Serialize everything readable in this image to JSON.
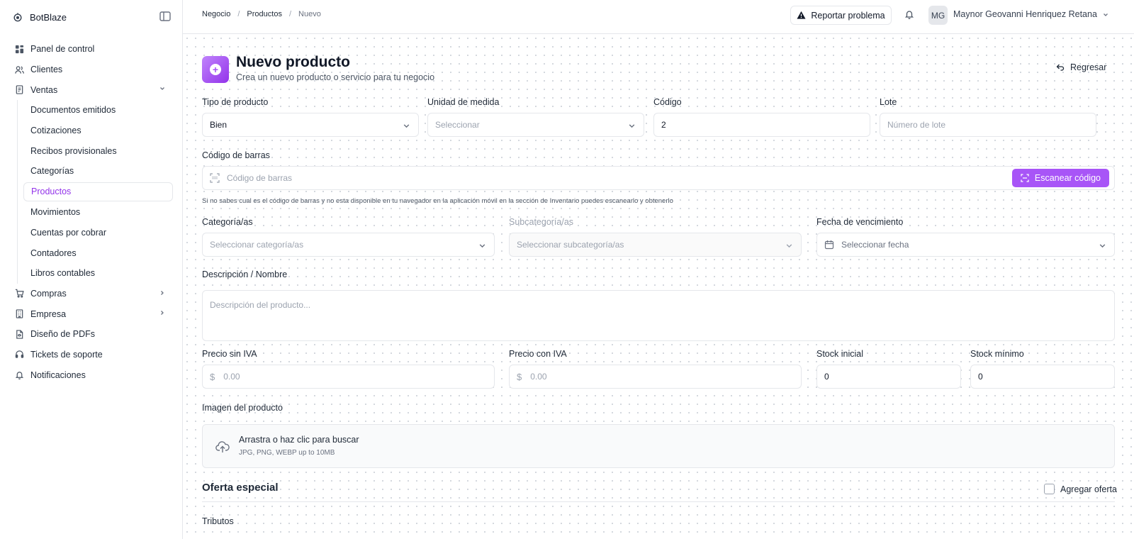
{
  "app": {
    "name": "BotBlaze"
  },
  "sidebar": {
    "items": [
      {
        "label": "Panel de control",
        "icon": "dashboard-icon"
      },
      {
        "label": "Clientes",
        "icon": "users-icon"
      },
      {
        "label": "Ventas",
        "icon": "receipt-icon",
        "expanded": true
      },
      {
        "label": "Compras",
        "icon": "cart-icon"
      },
      {
        "label": "Empresa",
        "icon": "building-icon"
      },
      {
        "label": "Diseño de PDFs",
        "icon": "pdf-icon"
      },
      {
        "label": "Tickets de soporte",
        "icon": "headset-icon"
      },
      {
        "label": "Notificaciones",
        "icon": "bell-icon"
      }
    ],
    "ventas_sub": [
      "Documentos emitidos",
      "Cotizaciones",
      "Recibos provisionales",
      "Categorías",
      "Productos",
      "Movimientos",
      "Cuentas por cobrar",
      "Contadores",
      "Libros contables"
    ],
    "active_sub": "Productos"
  },
  "header": {
    "breadcrumb": [
      "Negocio",
      "Productos",
      "Nuevo"
    ],
    "report_label": "Reportar problema",
    "avatar_initials": "MG",
    "user_name": "Maynor Geovanni Henriquez Retana"
  },
  "page": {
    "title": "Nuevo producto",
    "subtitle": "Crea un nuevo producto o servicio para tu negocio",
    "back_label": "Regresar"
  },
  "form": {
    "tipo": {
      "label": "Tipo de producto",
      "value": "Bien"
    },
    "unidad": {
      "label": "Unidad de medida",
      "placeholder": "Seleccionar"
    },
    "codigo": {
      "label": "Código",
      "value": "2"
    },
    "lote": {
      "label": "Lote",
      "placeholder": "Número de lote"
    },
    "barras": {
      "label": "Código de barras",
      "placeholder": "Código de barras",
      "scan_label": "Escanear código",
      "hint": "Si no sabes cual es el código de barras y no esta disponible en tu navegador en la aplicación móvil en la sección de Inventario puedes escanearlo y obtenerlo"
    },
    "categoria": {
      "label": "Categoría/as",
      "placeholder": "Seleccionar categoría/as"
    },
    "subcategoria": {
      "label": "Subcategoría/as",
      "placeholder": "Seleccionar subcategoría/as"
    },
    "vencimiento": {
      "label": "Fecha de vencimiento",
      "placeholder": "Seleccionar fecha"
    },
    "descripcion": {
      "label": "Descripción / Nombre",
      "placeholder": "Descripción del producto..."
    },
    "precio_sin": {
      "label": "Precio sin IVA",
      "placeholder": "0.00",
      "currency": "$"
    },
    "precio_con": {
      "label": "Precio con IVA",
      "placeholder": "0.00",
      "currency": "$"
    },
    "stock_inicial": {
      "label": "Stock inicial",
      "value": "0"
    },
    "stock_minimo": {
      "label": "Stock mínimo",
      "value": "0"
    },
    "imagen": {
      "label": "Imagen del producto",
      "title": "Arrastra o haz clic para buscar",
      "subtitle": "JPG, PNG, WEBP up to 10MB"
    },
    "oferta": {
      "title": "Oferta especial",
      "checkbox_label": "Agregar oferta",
      "checked": false
    },
    "tributos_label": "Tributos"
  },
  "colors": {
    "accent": "#a855f7",
    "accent_dark": "#9333ea",
    "border": "#e5e7eb"
  }
}
